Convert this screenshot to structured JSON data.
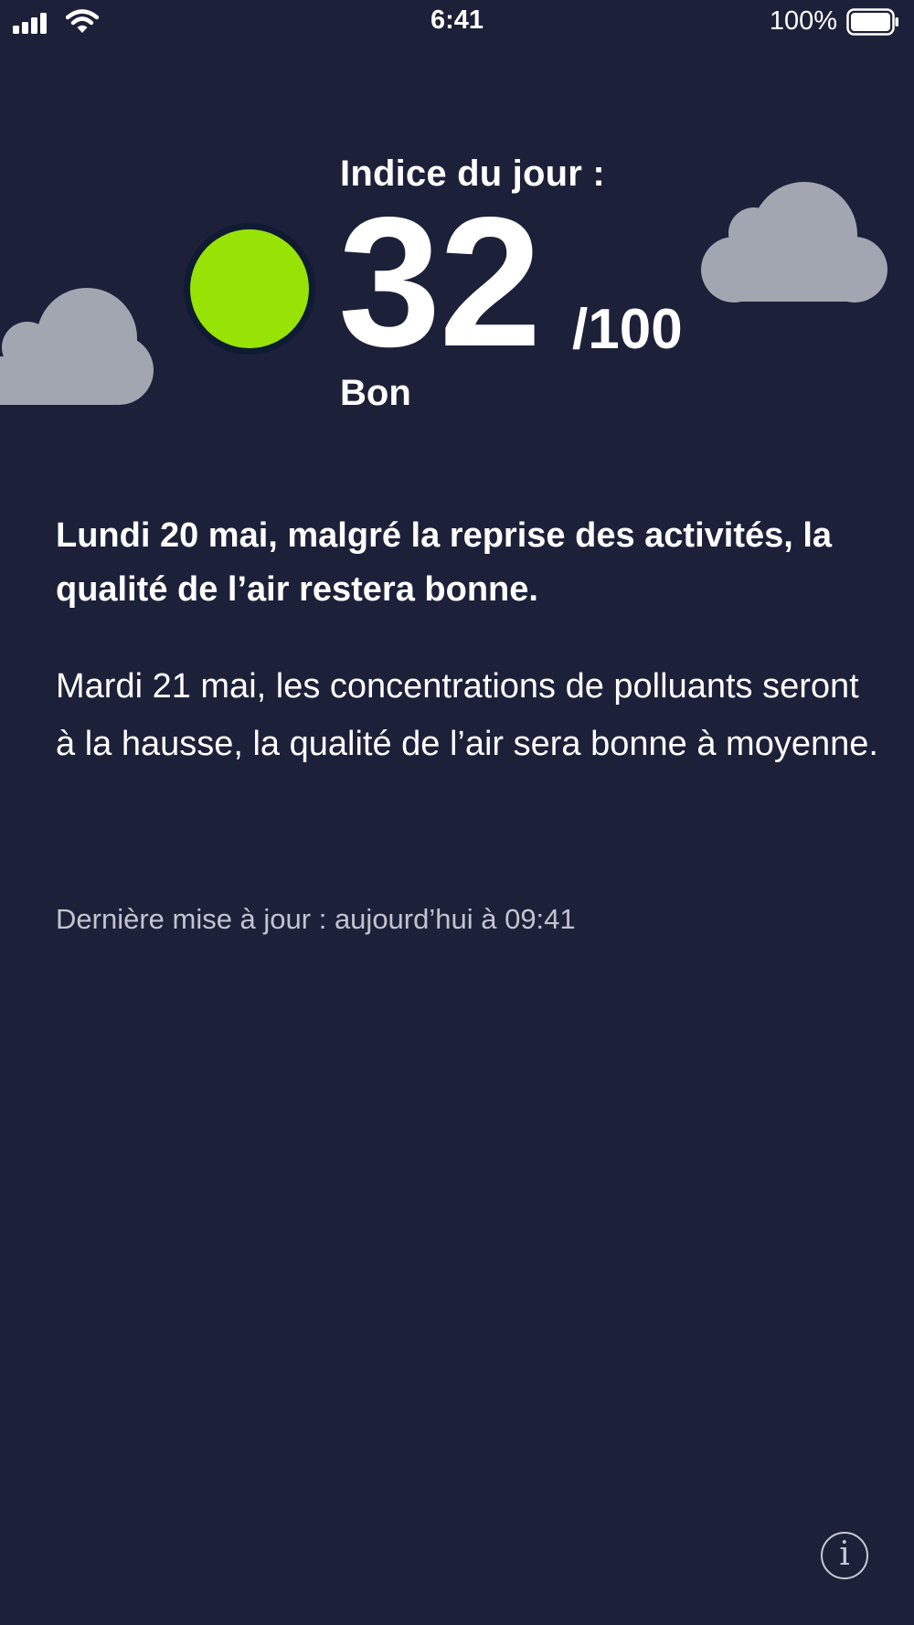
{
  "status_bar": {
    "time": "6:41",
    "battery_percent": "100%"
  },
  "aqi": {
    "label": "Indice du jour :",
    "value": "32",
    "max": "/100",
    "quality": "Bon",
    "color": "#98e306"
  },
  "summary": {
    "headline": "Lundi 20 mai, malgré la reprise des activités, la qualité de l’air restera bonne.",
    "forecast": "Mardi 21 mai, les concentrations de polluants seront à la hausse, la qualité de l’air sera bonne à moyenne."
  },
  "updated_text": "Dernière mise à jour : aujourd’hui à 09:41",
  "info_glyph": "i",
  "colors": {
    "background": "#1c2039",
    "cloud": "#a2a6b1",
    "secondary_text": "#c2c4cf"
  }
}
